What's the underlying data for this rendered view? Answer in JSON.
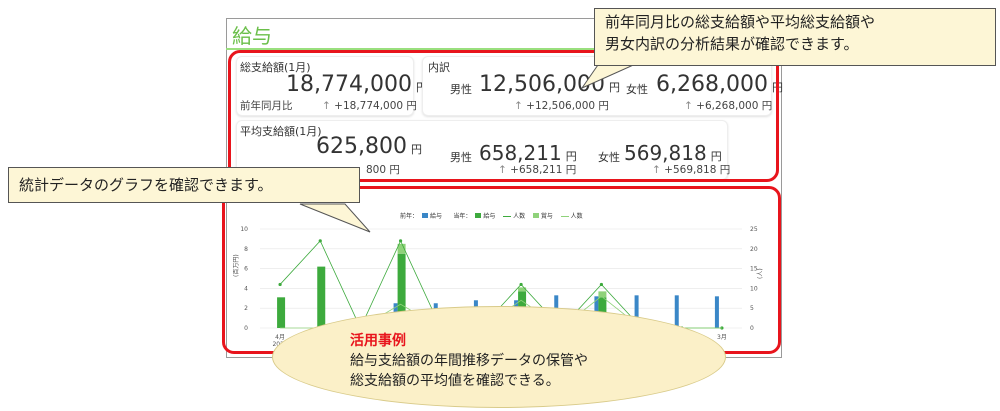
{
  "panel": {
    "title": "給与"
  },
  "total": {
    "label": "総支給額(1月)",
    "value": "18,774,000",
    "unit": "円",
    "yoy_label": "前年同月比",
    "yoy_arrow": "↑",
    "yoy_value": "+18,774,000 円"
  },
  "breakdown": {
    "label": "内訳",
    "male": {
      "label": "男性",
      "value": "12,506,000",
      "unit": "円",
      "arrow": "↑",
      "diff": "+12,506,000 円"
    },
    "female": {
      "label": "女性",
      "value": "6,268,000",
      "unit": "円",
      "arrow": "↑",
      "diff": "+6,268,000 円"
    }
  },
  "average": {
    "label": "平均支給額(1月)",
    "value": "625,800",
    "unit": "円",
    "partial_diff": "800 円",
    "male": {
      "label": "男性",
      "value": "658,211",
      "unit": "円",
      "arrow": "↑",
      "diff": "+658,211 円"
    },
    "female": {
      "label": "女性",
      "value": "569,818",
      "unit": "円",
      "arrow": "↑",
      "diff": "+569,818 円"
    }
  },
  "callouts": {
    "top_right": [
      "前年同月比の総支給額や平均総支給額や",
      "男女内訳の分析結果が確認できます。"
    ],
    "left": "統計データのグラフを確認できます。"
  },
  "example": {
    "title": "活用事例",
    "lines": [
      "給与支給額の年間推移データの保管や",
      "総支給額の平均値を確認できる。"
    ]
  },
  "legend": {
    "prev_label": "前年：",
    "prev_items": [
      "給与"
    ],
    "curr_label": "当年：",
    "curr_items": [
      "給与",
      "人数",
      "賞与",
      "人数"
    ]
  },
  "colors": {
    "accent_green": "#6bbf4a",
    "red": "#e8141c",
    "blue": "#3a87c7",
    "green": "#3daa3d",
    "light_green": "#8fd27a"
  },
  "chart_data": {
    "type": "bar",
    "xlabel": "",
    "ylabel_left": "(百万円)",
    "ylabel_right": "(人)",
    "x_tick_labels": [
      "4月",
      "3月"
    ],
    "x_tick_sublabel": "2021",
    "ylim_left": [
      0,
      10
    ],
    "ylim_right": [
      0,
      25
    ],
    "yticks_left": [
      0,
      2,
      4,
      6,
      8,
      10
    ],
    "yticks_right": [
      0,
      5,
      10,
      15,
      20,
      25
    ],
    "months": 12,
    "series": [
      {
        "name": "給与",
        "kind": "bar",
        "year": "prev",
        "values": [
          0,
          0,
          0,
          2.5,
          2.5,
          2.8,
          2.8,
          3.3,
          3.2,
          3.3,
          3.3,
          3.2
        ]
      },
      {
        "name": "給与",
        "kind": "bar",
        "year": "curr",
        "values": [
          3.1,
          6.2,
          0,
          7.5,
          0,
          0,
          3.7,
          0,
          3.1,
          0,
          0,
          0
        ]
      },
      {
        "name": "賞与",
        "kind": "bar",
        "year": "curr",
        "values": [
          0,
          0,
          0,
          1.0,
          0,
          0,
          0.4,
          0,
          0.6,
          0,
          0,
          0
        ]
      },
      {
        "name": "人数",
        "kind": "line",
        "year": "curr",
        "values": [
          11,
          22,
          0,
          22,
          0,
          0,
          11,
          0,
          11,
          0,
          0,
          0
        ]
      },
      {
        "name": "人数",
        "kind": "line",
        "year": "prev",
        "values": [
          0,
          0,
          0,
          6,
          0,
          0,
          7,
          0,
          8,
          0,
          0,
          0
        ]
      }
    ],
    "grid": true
  }
}
